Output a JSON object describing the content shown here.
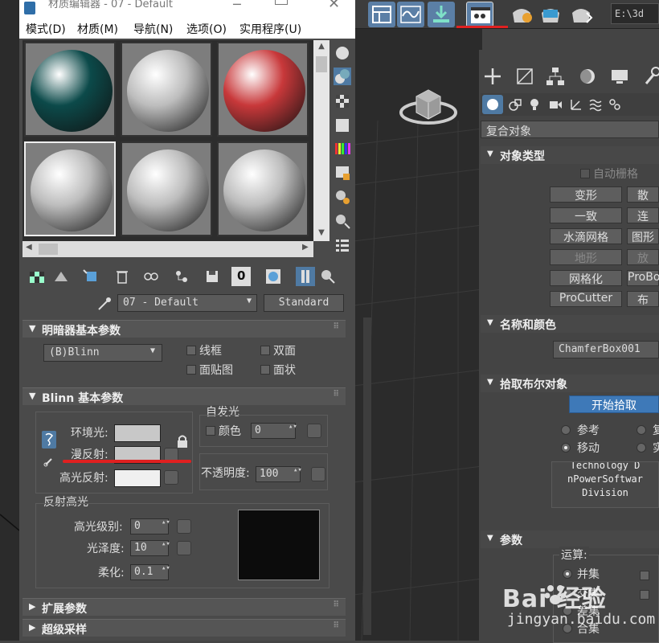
{
  "window": {
    "title": "材质编辑器 - 07 - Default",
    "path": "E:\\3d"
  },
  "menu": [
    "模式(D)",
    "材质(M)",
    "导航(N)",
    "选项(O)",
    "实用程序(U)"
  ],
  "material": {
    "slots": [
      {
        "color": "#0c4a4a"
      },
      {
        "color": "#bdbdbd"
      },
      {
        "color": "#c8383a"
      },
      {
        "color": "#bdbdbd"
      },
      {
        "color": "#bdbdbd"
      },
      {
        "color": "#bdbdbd"
      }
    ],
    "name": "07 - Default",
    "type_button": "Standard"
  },
  "shader": {
    "header": "明暗器基本参数",
    "shader_type": "(B)Blinn",
    "wire": "线框",
    "two_sided": "双面",
    "face_map": "面贴图",
    "faceted": "面状"
  },
  "blinn": {
    "header": "Blinn 基本参数",
    "ambient": "环境光:",
    "diffuse": "漫反射:",
    "specular": "高光反射:",
    "self_illum_title": "自发光",
    "color_label": "颜色",
    "color_value": "0",
    "opacity_label": "不透明度:",
    "opacity_value": "100",
    "specular_highlights": "反射高光",
    "spec_level_label": "高光级别:",
    "spec_level_value": "0",
    "glossiness_label": "光泽度:",
    "glossiness_value": "10",
    "soften_label": "柔化:",
    "soften_value": "0.1"
  },
  "rollouts": {
    "extended": "扩展参数",
    "supersampling": "超级采样"
  },
  "command_panel": {
    "category": "复合对象",
    "object_type_header": "对象类型",
    "auto_grid": "自动栅格",
    "buttons": [
      {
        "label": "变形",
        "enabled": true
      },
      {
        "label": "散",
        "enabled": true
      },
      {
        "label": "一致",
        "enabled": true
      },
      {
        "label": "连",
        "enabled": true
      },
      {
        "label": "水滴网格",
        "enabled": true
      },
      {
        "label": "图形",
        "enabled": true
      },
      {
        "label": "地形",
        "enabled": false
      },
      {
        "label": "放",
        "enabled": false
      },
      {
        "label": "网格化",
        "enabled": true
      },
      {
        "label": "ProBo",
        "enabled": true
      },
      {
        "label": "ProCutter",
        "enabled": true
      },
      {
        "label": "布",
        "enabled": true
      }
    ],
    "name_color_header": "名称和颜色",
    "object_name": "ChamferBox001",
    "pick_boolean_header": "拾取布尔对象",
    "start_pick": "开始拾取",
    "reference": "参考",
    "copy_partial": "复",
    "move": "移动",
    "instance_partial": "实",
    "info_lines": [
      "Technology D",
      "nPowerSoftwar",
      "Division"
    ],
    "params_header": "参数",
    "operation_label": "运算:",
    "union": "并集",
    "intersection": "交集",
    "subtraction": "差集",
    "merge": "合集"
  },
  "watermark": {
    "brand": "Bai 经验",
    "url": "jingyan.baidu.com"
  }
}
